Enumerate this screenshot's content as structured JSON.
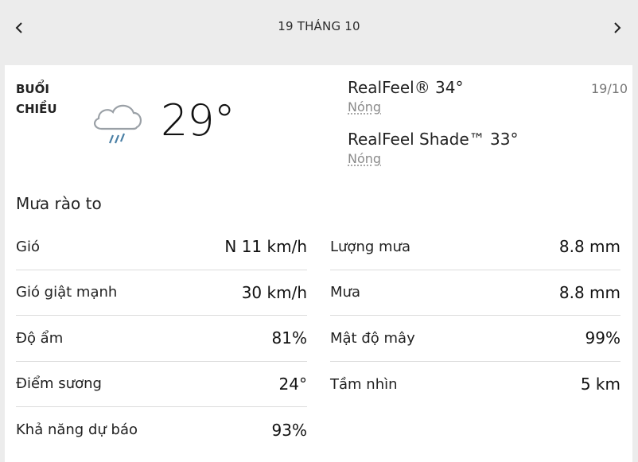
{
  "header": {
    "title": "19 THÁNG 10",
    "prev_icon": "chevron-left-icon",
    "next_icon": "chevron-right-icon"
  },
  "forecast": {
    "period_line1": "BUỔI",
    "period_line2": "CHIỀU",
    "icon": "rain-cloud-icon",
    "temperature": "29°",
    "realfeel": "RealFeel® 34°",
    "realfeel_desc": "Nóng",
    "realfeel_shade": "RealFeel Shade™ 33°",
    "realfeel_shade_desc": "Nóng",
    "date": "19/10",
    "phrase": "Mưa rào to"
  },
  "details_left": [
    {
      "label": "Gió",
      "value": "N 11 km/h"
    },
    {
      "label": "Gió giật mạnh",
      "value": "30 km/h"
    },
    {
      "label": "Độ ẩm",
      "value": "81%"
    },
    {
      "label": "Điểm sương",
      "value": "24°"
    },
    {
      "label": "Khả năng dự báo",
      "value": "93%"
    }
  ],
  "details_right": [
    {
      "label": "Lượng mưa",
      "value": "8.8 mm"
    },
    {
      "label": "Mưa",
      "value": "8.8 mm"
    },
    {
      "label": "Mật độ mây",
      "value": "99%"
    },
    {
      "label": "Tầm nhìn",
      "value": "5 km"
    }
  ],
  "colors": {
    "background": "#ececec",
    "card": "#ffffff",
    "muted": "#8a8a8a",
    "rain": "#4a7fa5",
    "cloud": "#9aa0a6"
  }
}
